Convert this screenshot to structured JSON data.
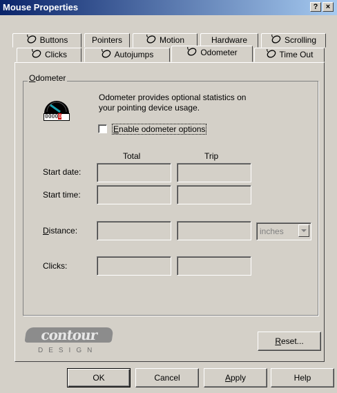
{
  "window": {
    "title": "Mouse Properties",
    "help_glyph": "?",
    "close_glyph": "×"
  },
  "tabs_row1": [
    {
      "label": "Buttons",
      "icon": "mouse-icon"
    },
    {
      "label": "Pointers",
      "icon": ""
    },
    {
      "label": "Motion",
      "icon": "mouse-icon"
    },
    {
      "label": "Hardware",
      "icon": ""
    },
    {
      "label": "Scrolling",
      "icon": "mouse-icon"
    }
  ],
  "tabs_row2": [
    {
      "label": "Clicks",
      "icon": "mouse-icon"
    },
    {
      "label": "Autojumps",
      "icon": "mouse-icon"
    },
    {
      "label": "Odometer",
      "icon": "mouse-icon",
      "active": true
    },
    {
      "label": "Time Out",
      "icon": "mouse-icon"
    }
  ],
  "odometer": {
    "group_label_mnemonic": "O",
    "group_label_rest": "dometer",
    "description_line1": "Odometer provides optional statistics on",
    "description_line2": "your pointing device usage.",
    "counter_digits": "0000",
    "counter_last_digit": "0",
    "enable_mnemonic": "E",
    "enable_rest": "nable odometer options",
    "enable_checked": false,
    "col_total": "Total",
    "col_trip": "Trip",
    "start_date_label": "Start date:",
    "start_time_label": "Start time:",
    "distance_mnemonic": "D",
    "distance_rest": "istance:",
    "clicks_label": "Clicks:",
    "units_value": "inches",
    "fields": {
      "start_date_total": "",
      "start_date_trip": "",
      "start_time_total": "",
      "start_time_trip": "",
      "distance_total": "",
      "distance_trip": "",
      "clicks_total": "",
      "clicks_trip": ""
    }
  },
  "logo": {
    "wordmark": "contour",
    "subtitle": "DESIGN"
  },
  "reset": {
    "mnemonic": "R",
    "rest": "eset..."
  },
  "footer": {
    "ok": "OK",
    "cancel": "Cancel",
    "apply_mnemonic": "A",
    "apply_rest": "pply",
    "help": "Help"
  },
  "colors": {
    "title_start": "#0a246a",
    "title_end": "#a6caf0",
    "face": "#d4d0c8",
    "counter_red": "#cc0000"
  }
}
